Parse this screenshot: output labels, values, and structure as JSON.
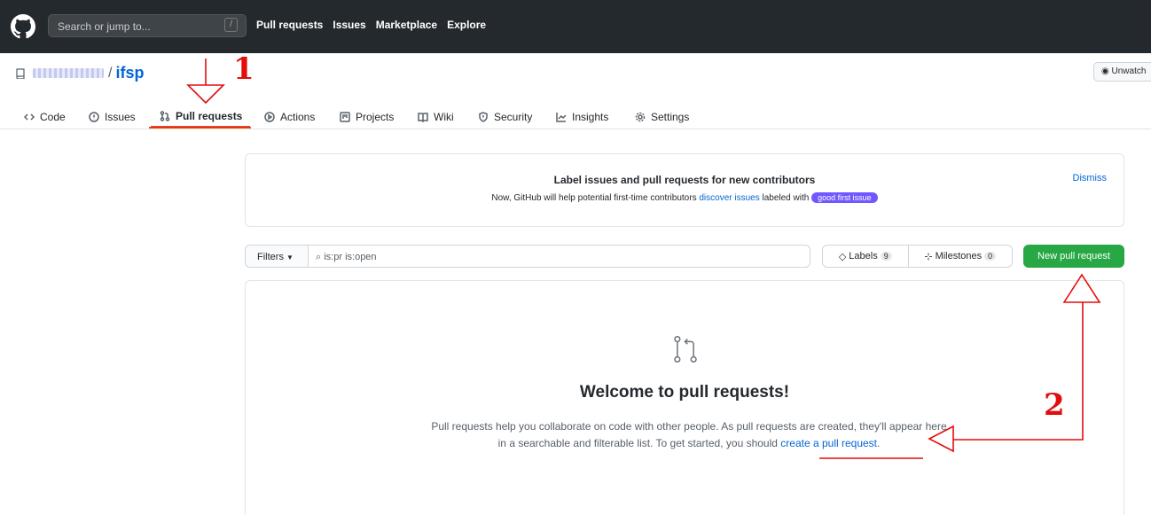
{
  "topbar": {
    "search_placeholder": "Search or jump to...",
    "search_shortcut": "/",
    "nav": [
      "Pull requests",
      "Issues",
      "Marketplace",
      "Explore"
    ]
  },
  "repo": {
    "slash": "/",
    "name": "ifsp",
    "unwatch_label": "Unwatch"
  },
  "tabs": [
    "Code",
    "Issues",
    "Pull requests",
    "Actions",
    "Projects",
    "Wiki",
    "Security",
    "Insights",
    "Settings"
  ],
  "notice": {
    "title": "Label issues and pull requests for new contributors",
    "text_before": "Now, GitHub will help potential first-time contributors ",
    "link": "discover issues",
    "text_after": " labeled with ",
    "badge": "good first issue",
    "dismiss": "Dismiss"
  },
  "filterbar": {
    "filters_label": "Filters",
    "query": "is:pr is:open",
    "labels_label": "Labels",
    "labels_count": "9",
    "milestones_label": "Milestones",
    "milestones_count": "0",
    "new_pr_label": "New pull request"
  },
  "blankslate": {
    "title": "Welcome to pull requests!",
    "text": "Pull requests help you collaborate on code with other people. As pull requests are created, they'll appear here in a searchable and filterable list. To get started, you should ",
    "link": "create a pull request",
    "period": "."
  },
  "annotations": {
    "step1": "1",
    "step2": "2"
  },
  "colors": {
    "annotation_red": "#e30d0d",
    "primary_green": "#28a745",
    "link_blue": "#0366d6",
    "badge_purple": "#7057ff"
  }
}
